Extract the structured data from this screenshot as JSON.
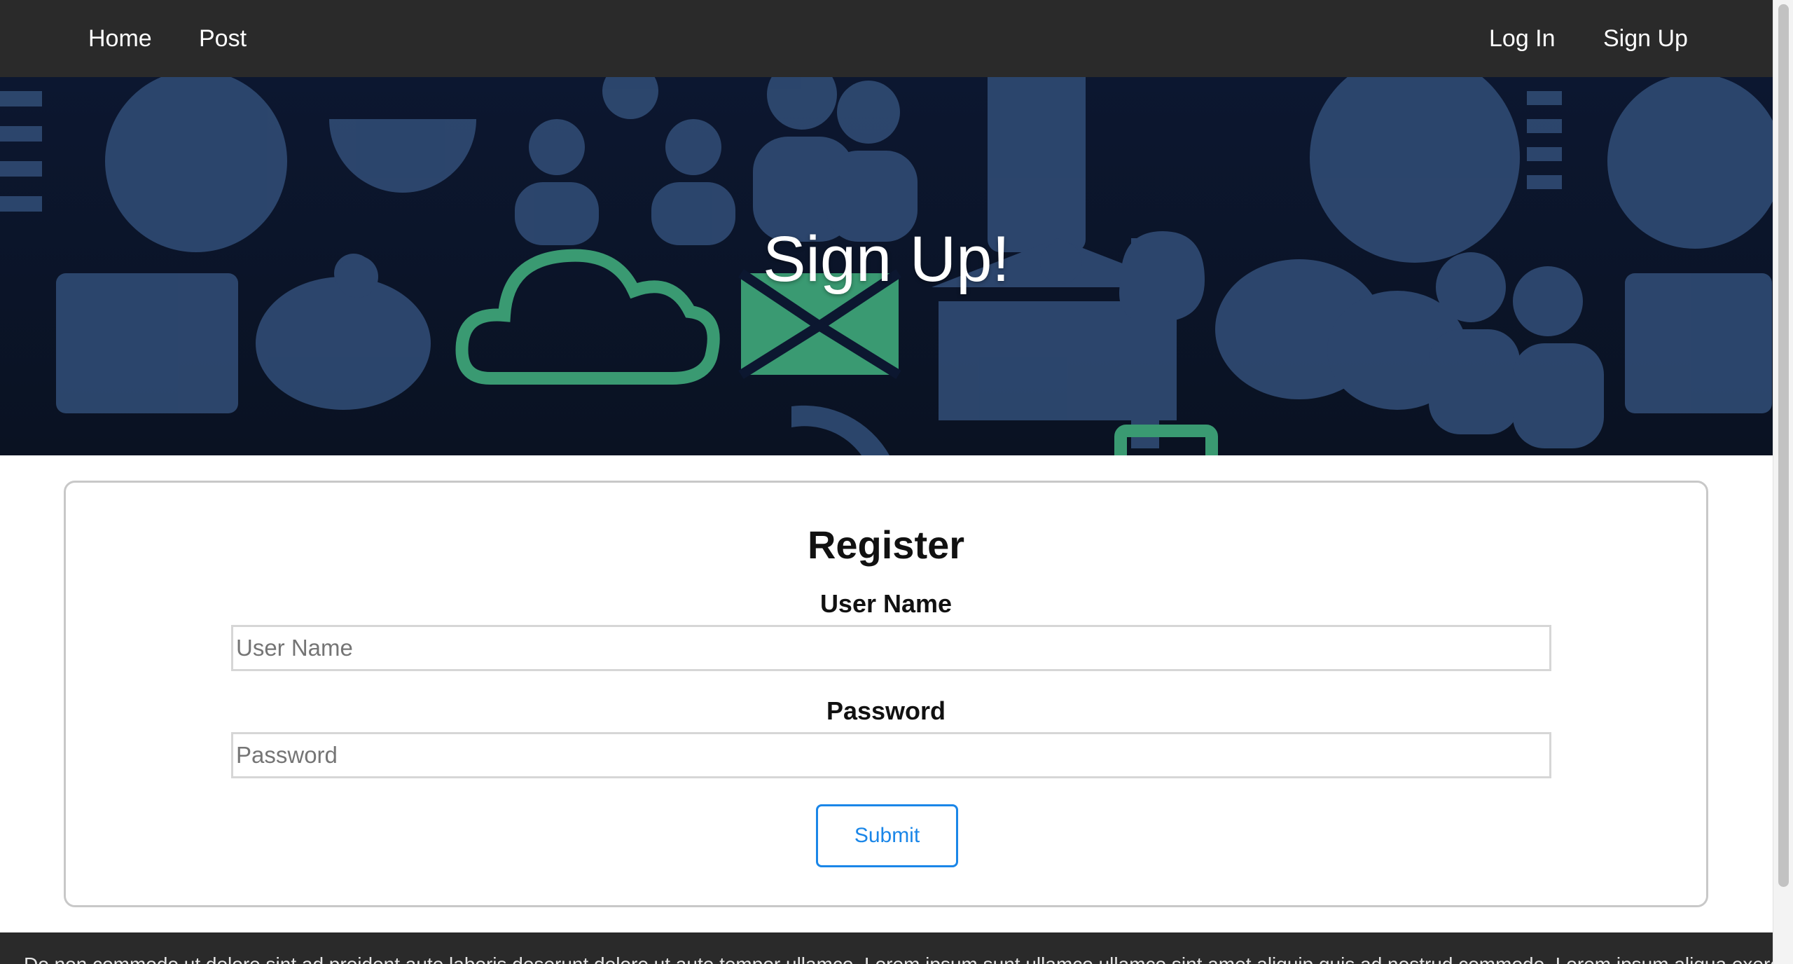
{
  "navbar": {
    "left_links": [
      "Home",
      "Post"
    ],
    "right_links": [
      "Log In",
      "Sign Up"
    ]
  },
  "hero": {
    "title": "Sign Up!"
  },
  "register": {
    "title": "Register",
    "username_label": "User Name",
    "username_placeholder": "User Name",
    "password_label": "Password",
    "password_placeholder": "Password",
    "submit_label": "Submit"
  },
  "footer": {
    "text": "Do non commodo ut dolore sint ad proident aute laboris deserunt dolore ut aute tempor ullamco. Lorem ipsum sunt ullamco ullamco sint amet aliquip quis ad nostrud commodo. Lorem ipsum aliqua exercitation enim"
  },
  "colors": {
    "navbar_bg": "#2a2a2a",
    "hero_bg": "#0b1426",
    "hero_icon": "#2f4a72",
    "hero_accent": "#3a9a72",
    "button_accent": "#1a86e8"
  }
}
